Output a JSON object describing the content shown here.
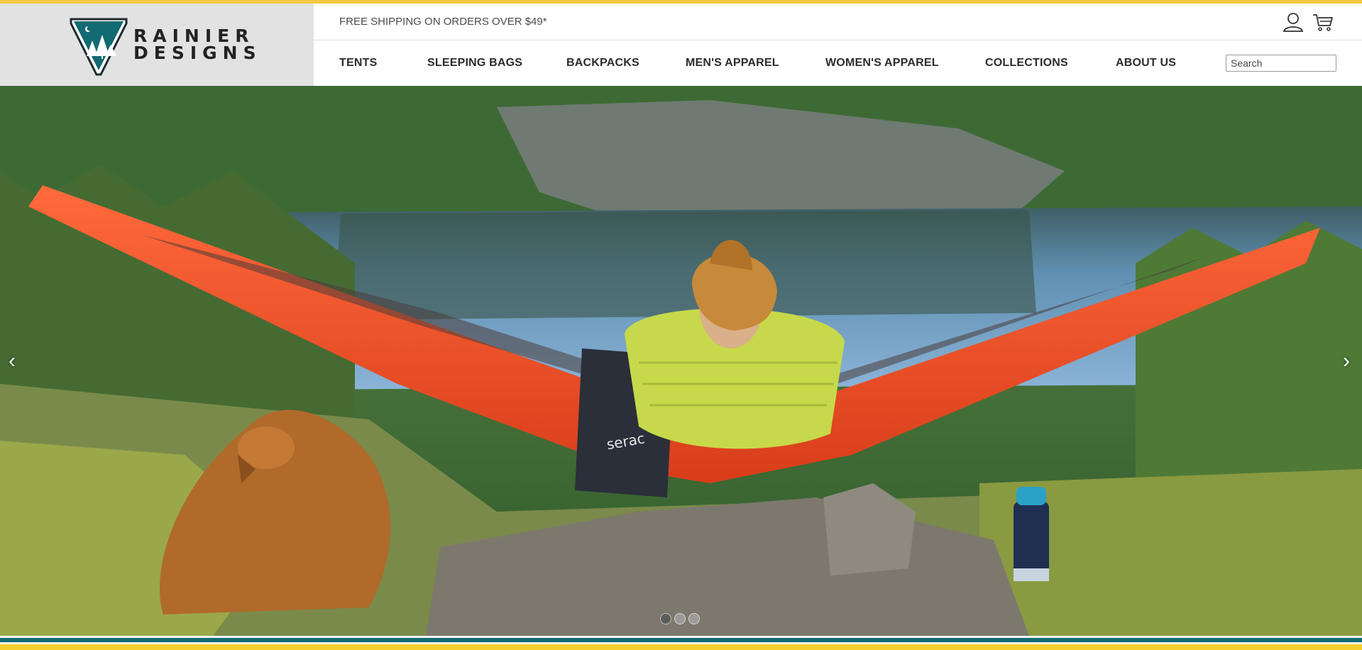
{
  "brand": {
    "name_line1": "RAINIER",
    "name_line2": "DESIGNS",
    "colors": {
      "accent_yellow": "#f5c842",
      "teal": "#126a72"
    }
  },
  "utility": {
    "promo_text": "FREE SHIPPING ON ORDERS OVER $49*",
    "icons": [
      "user-icon",
      "cart-icon"
    ]
  },
  "nav": {
    "items": [
      {
        "label": "TENTS"
      },
      {
        "label": "SLEEPING BAGS"
      },
      {
        "label": "BACKPACKS"
      },
      {
        "label": "MEN'S APPAREL"
      },
      {
        "label": "WOMEN'S APPAREL"
      },
      {
        "label": "COLLECTIONS"
      },
      {
        "label": "ABOUT US"
      }
    ]
  },
  "search": {
    "placeholder": "Search",
    "value": ""
  },
  "hero": {
    "prev_arrow": "‹",
    "next_arrow": "›",
    "slide_count": 3,
    "active_slide": 1,
    "bag_label": "serac"
  }
}
